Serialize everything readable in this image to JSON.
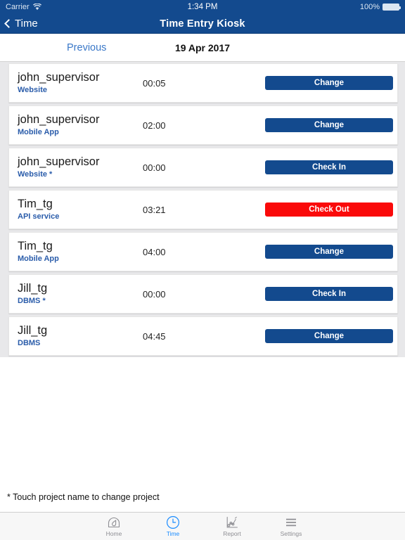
{
  "status_bar": {
    "carrier": "Carrier",
    "wifi_icon": "wifi-icon",
    "time": "1:34 PM",
    "battery_percent": "100%",
    "battery_icon": "battery-icon"
  },
  "nav_bar": {
    "back_icon": "chevron-left-icon",
    "back_label": "Time",
    "title": "Time Entry Kiosk",
    "background_color": "#134a8e"
  },
  "sub_header": {
    "previous_label": "Previous",
    "date": "19 Apr 2017"
  },
  "colors": {
    "primary_blue": "#134a8e",
    "link_blue": "#2a5caa",
    "danger_red": "#fa0a0a",
    "tab_active": "#1a8cff"
  },
  "entries": [
    {
      "user": "john_supervisor",
      "project": "Website",
      "time": "00:05",
      "action": "Change",
      "action_style": "blue"
    },
    {
      "user": "john_supervisor",
      "project": "Mobile App",
      "time": "02:00",
      "action": "Change",
      "action_style": "blue"
    },
    {
      "user": "john_supervisor",
      "project": "Website *",
      "time": "00:00",
      "action": "Check In",
      "action_style": "blue"
    },
    {
      "user": "Tim_tg",
      "project": "API service",
      "time": "03:21",
      "action": "Check Out",
      "action_style": "red"
    },
    {
      "user": "Tim_tg",
      "project": "Mobile App",
      "time": "04:00",
      "action": "Change",
      "action_style": "blue"
    },
    {
      "user": "Jill_tg",
      "project": "DBMS *",
      "time": "00:00",
      "action": "Check In",
      "action_style": "blue"
    },
    {
      "user": "Jill_tg",
      "project": "DBMS",
      "time": "04:45",
      "action": "Change",
      "action_style": "blue"
    }
  ],
  "footnote": "* Touch project name to change project",
  "tab_bar": {
    "items": [
      {
        "label": "Home",
        "icon": "gauge-icon",
        "active": false
      },
      {
        "label": "Time",
        "icon": "clock-icon",
        "active": true
      },
      {
        "label": "Report",
        "icon": "chart-icon",
        "active": false
      },
      {
        "label": "Settings",
        "icon": "hamburger-icon",
        "active": false
      }
    ]
  }
}
